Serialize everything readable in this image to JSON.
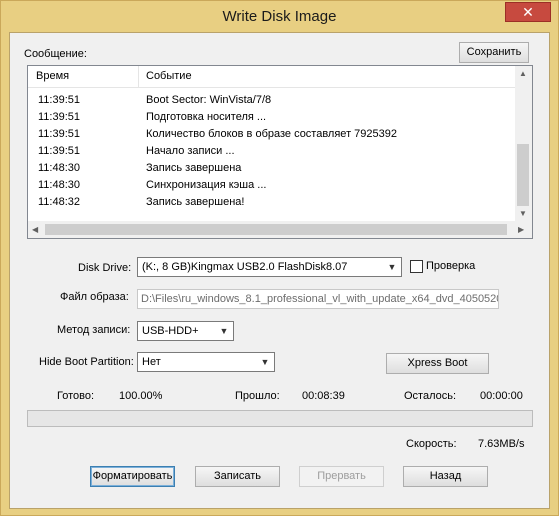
{
  "window": {
    "title": "Write Disk Image",
    "close_glyph": "✕"
  },
  "log": {
    "section_label": "Сообщение:",
    "save_label": "Сохранить",
    "columns": {
      "time": "Время",
      "event": "Событие"
    },
    "rows": [
      {
        "time": "11:39:51",
        "event": "Boot Sector: WinVista/7/8"
      },
      {
        "time": "11:39:51",
        "event": "Подготовка носителя ..."
      },
      {
        "time": "11:39:51",
        "event": "Количество блоков в образе составляет 7925392"
      },
      {
        "time": "11:39:51",
        "event": "Начало записи ..."
      },
      {
        "time": "11:48:30",
        "event": "Запись завершена"
      },
      {
        "time": "11:48:30",
        "event": "Синхронизация кэша ..."
      },
      {
        "time": "11:48:32",
        "event": "Запись завершена!"
      }
    ]
  },
  "form": {
    "disk_drive_label": "Disk Drive:",
    "disk_drive_value": "(K:, 8 GB)Kingmax USB2.0 FlashDisk8.07",
    "verify_label": "Проверка",
    "image_file_label": "Файл образа:",
    "image_file_value": "D:\\Files\\ru_windows_8.1_professional_vl_with_update_x64_dvd_4050520",
    "write_method_label": "Метод записи:",
    "write_method_value": "USB-HDD+",
    "hide_boot_label": "Hide Boot Partition:",
    "hide_boot_value": "Нет",
    "xpress_boot_label": "Xpress Boot"
  },
  "status": {
    "done_label": "Готово:",
    "done_value": "100.00%",
    "elapsed_label": "Прошло:",
    "elapsed_value": "00:08:39",
    "remaining_label": "Осталось:",
    "remaining_value": "00:00:00",
    "progress_fraction": 1.0,
    "speed_label": "Скорость:",
    "speed_value": "7.63MB/s"
  },
  "buttons": {
    "format": "Форматировать",
    "write": "Записать",
    "abort": "Прервать",
    "back": "Назад"
  },
  "icons": {
    "dropdown": "▼",
    "scroll_up": "▲",
    "scroll_down": "▼",
    "scroll_left": "◀",
    "scroll_right": "▶"
  }
}
